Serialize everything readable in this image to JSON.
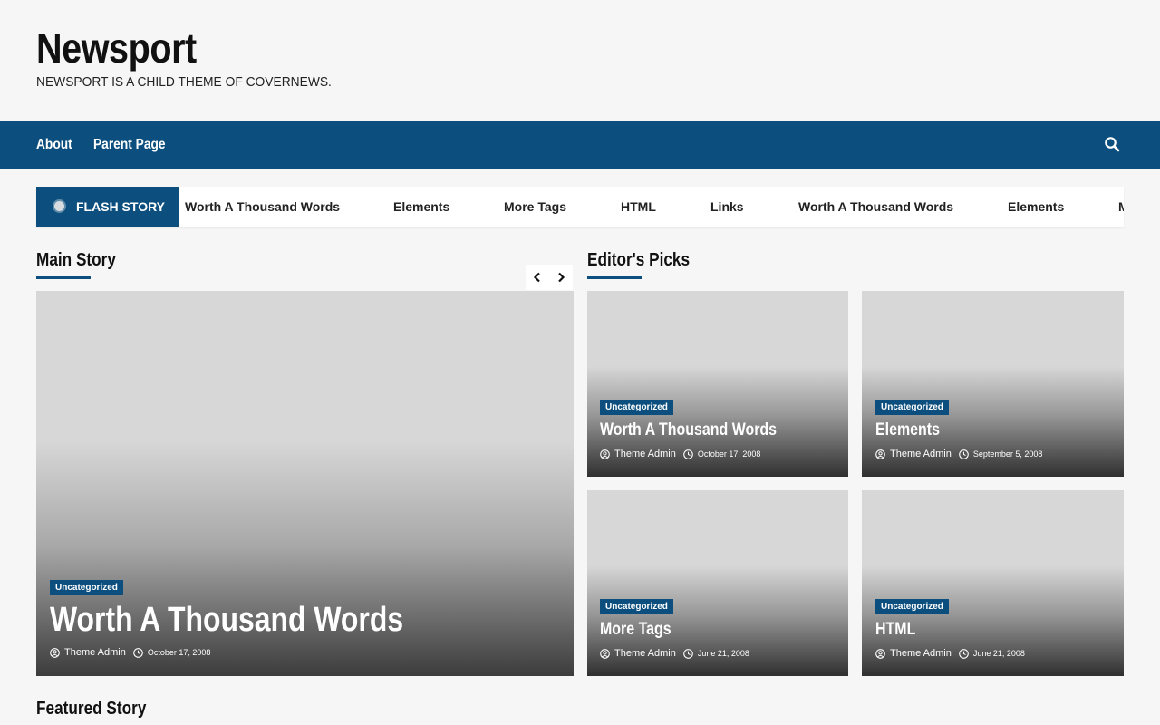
{
  "site": {
    "title": "Newsport",
    "description": "NEWSPORT IS A CHILD THEME OF COVERNEWS."
  },
  "nav": {
    "items": [
      "About",
      "Parent Page"
    ],
    "search_icon": "search-icon"
  },
  "colors": {
    "primary": "#0c4f7e",
    "page_bg": "#f6f6f6",
    "placeholder": "#d7d7d7"
  },
  "flash": {
    "label": "FLASH STORY",
    "items": [
      "Worth A Thousand Words",
      "Elements",
      "More Tags",
      "HTML",
      "Links",
      "Worth A Thousand Words",
      "Elements",
      "M"
    ]
  },
  "main_story": {
    "title": "Main Story",
    "prev_icon": "chevron-left-icon",
    "next_icon": "chevron-right-icon",
    "post": {
      "category": "Uncategorized",
      "title": "Worth A Thousand Words",
      "author": "Theme Admin",
      "date": "October 17, 2008"
    }
  },
  "editors_picks": {
    "title": "Editor's Picks",
    "posts": [
      {
        "category": "Uncategorized",
        "title": "Worth A Thousand Words",
        "author": "Theme Admin",
        "date": "October 17, 2008"
      },
      {
        "category": "Uncategorized",
        "title": "Elements",
        "author": "Theme Admin",
        "date": "September 5, 2008"
      },
      {
        "category": "Uncategorized",
        "title": "More Tags",
        "author": "Theme Admin",
        "date": "June 21, 2008"
      },
      {
        "category": "Uncategorized",
        "title": "HTML",
        "author": "Theme Admin",
        "date": "June 21, 2008"
      }
    ]
  },
  "featured_story": {
    "title": "Featured Story"
  }
}
